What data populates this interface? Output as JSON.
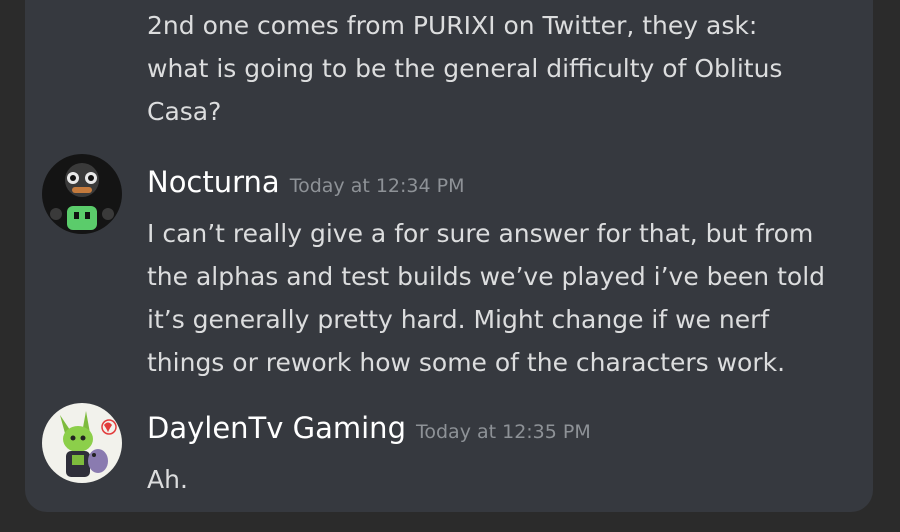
{
  "messages": [
    {
      "lines": [
        "2nd one comes from PURIXI on Twitter, they ask:",
        "what is going to be the general difficulty of Oblitus",
        "Casa?"
      ]
    },
    {
      "author": "Nocturna",
      "timestamp": "Today at 12:34 PM",
      "avatar_icon": "nocturna-avatar",
      "lines": [
        "I can’t really give a for sure answer for that, but from",
        "the alphas and test builds we’ve played i’ve been told",
        "it’s generally pretty hard. Might change if we nerf",
        "things or rework how some of the characters work."
      ]
    },
    {
      "author": "DaylenTv Gaming",
      "timestamp": "Today at 12:35 PM",
      "avatar_icon": "daylen-avatar",
      "lines": [
        "Ah."
      ]
    }
  ],
  "colors": {
    "background": "#36393f",
    "author": "#ffffff",
    "text": "#dcddde",
    "timestamp": "#8e9297"
  }
}
